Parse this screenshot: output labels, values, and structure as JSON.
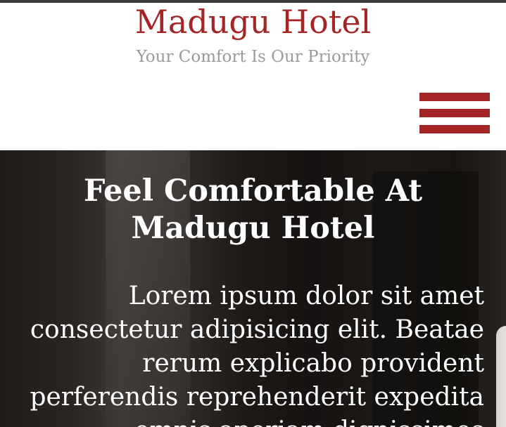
{
  "header": {
    "site_title": "Madugu Hotel",
    "tagline": "Your Comfort Is Our Priority",
    "menu_icon": "hamburger-menu-icon"
  },
  "hero": {
    "title": "Feel Comfortable At Madugu Hotel",
    "text": "Lorem ipsum dolor sit amet consectetur adipisicing elit. Beatae rerum explicabo provident perferendis reprehenderit expedita omnis aperiam dignissimos"
  },
  "colors": {
    "brand": "#a32626",
    "tagline": "#9a9a9a",
    "hero_text": "#ffffff"
  }
}
